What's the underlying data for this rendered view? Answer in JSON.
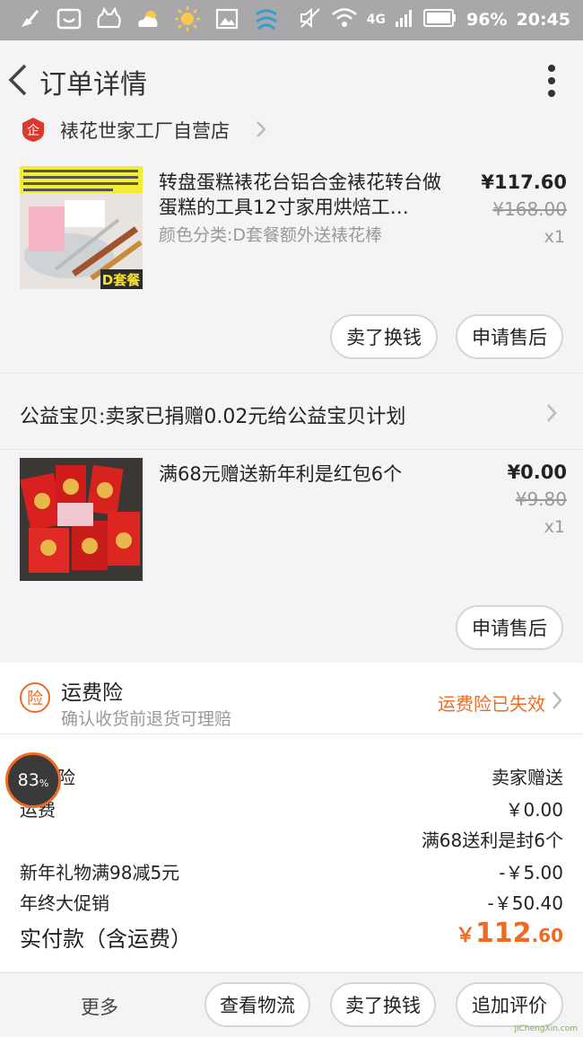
{
  "status_bar": {
    "network": "4G",
    "battery": "96%",
    "time": "20:45"
  },
  "header": {
    "title": "订单详情"
  },
  "shop": {
    "name": "裱花世家工厂自营店"
  },
  "items": [
    {
      "title": "转盘蛋糕裱花台铝合金裱花转台做蛋糕的工具12寸家用烘焙工…",
      "sku": "颜色分类:D套餐额外送裱花棒",
      "price": "¥117.60",
      "original_price": "¥168.00",
      "qty": "x1",
      "thumb_label": "D套餐",
      "buttons": [
        "卖了换钱",
        "申请售后"
      ]
    },
    {
      "title": "满68元赠送新年利是红包6个",
      "price": "¥0.00",
      "original_price": "¥9.80",
      "qty": "x1",
      "buttons": [
        "申请售后"
      ]
    }
  ],
  "charity": {
    "text": "公益宝贝:卖家已捐赠0.02元给公益宝贝计划"
  },
  "insurance": {
    "icon_char": "险",
    "title": "运费险",
    "subtitle": "确认收货前退货可理赔",
    "status": "运费险已失效"
  },
  "summary": {
    "rows": [
      {
        "label": "险",
        "value": "卖家赠送"
      },
      {
        "label": "运费",
        "value": "￥0.00"
      },
      {
        "label": "",
        "value": "满68送利是封6个"
      },
      {
        "label": "新年礼物满98减5元",
        "value": "-￥5.00"
      },
      {
        "label": "年终大促销",
        "value": "-￥50.40"
      }
    ],
    "total_label": "实付款（含运费）",
    "total_currency": "￥",
    "total_int": "112",
    "total_dec": ".60"
  },
  "bottom_bar": {
    "more": "更多",
    "buttons": [
      "查看物流",
      "卖了换钱",
      "追加评价"
    ]
  },
  "float_ball": {
    "value": "83",
    "unit": "%"
  },
  "watermark": "JiChengXin.com",
  "colors": {
    "accent": "#f06a22",
    "status_bar": "#a8a8ab",
    "page_bg": "#f4f3f6"
  }
}
